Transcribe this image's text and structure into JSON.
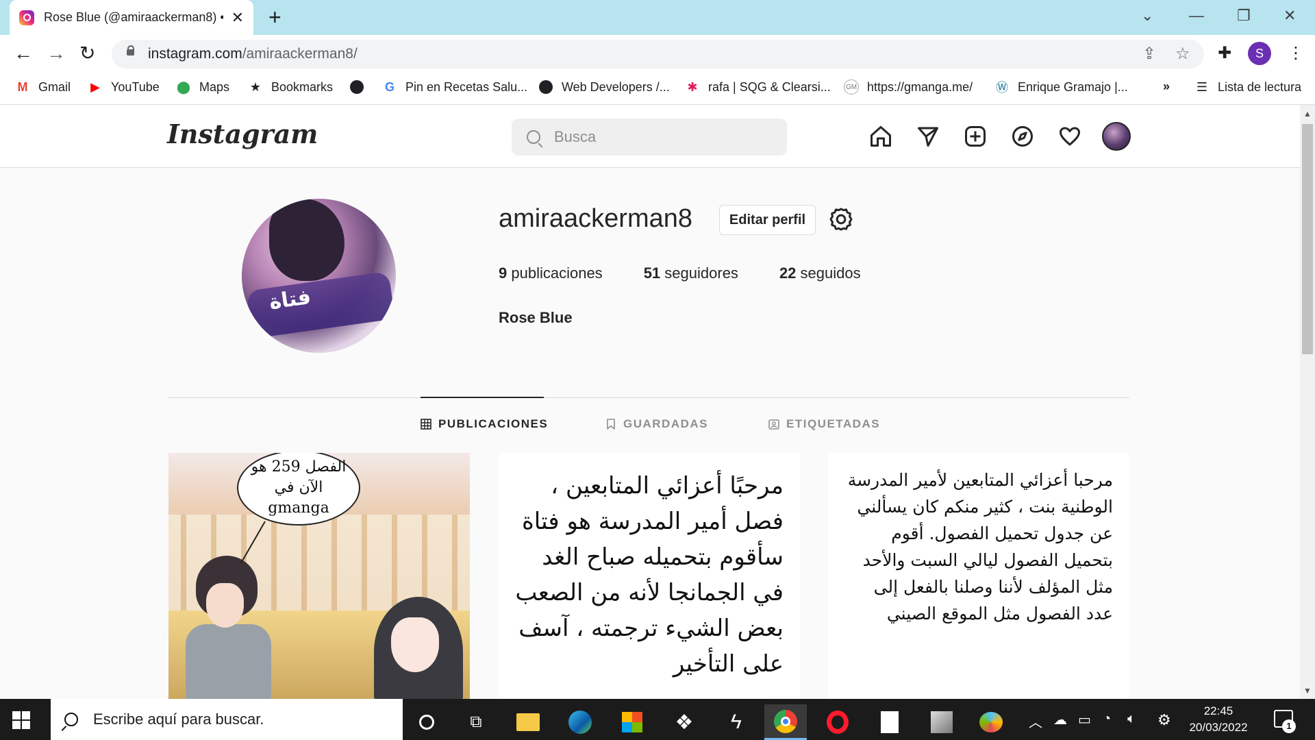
{
  "browser": {
    "tab_title": "Rose Blue (@amiraackerman8) • I",
    "url_host": "instagram.com",
    "url_path": "/amiraackerman8/",
    "profile_initial": "S",
    "bookmarks": [
      {
        "label": "Gmail",
        "icon": "gmail-icon"
      },
      {
        "label": "YouTube",
        "icon": "youtube-icon"
      },
      {
        "label": "Maps",
        "icon": "maps-icon"
      },
      {
        "label": "Bookmarks",
        "icon": "star-icon"
      },
      {
        "label": "",
        "icon": "globe-icon"
      },
      {
        "label": "Pin en Recetas Salu...",
        "icon": "google-icon"
      },
      {
        "label": "Web Developers /...",
        "icon": "globe-icon"
      },
      {
        "label": "rafa | SQG & Clearsi...",
        "icon": "slack-icon"
      },
      {
        "label": "https://gmanga.me/",
        "icon": "gmanga-icon"
      },
      {
        "label": "Enrique Gramajo |...",
        "icon": "wordpress-icon"
      }
    ],
    "bookmarks_overflow": "»",
    "reading_list": "Lista de lectura"
  },
  "instagram": {
    "logo": "Instagram",
    "search_placeholder": "Busca",
    "username": "amiraackerman8",
    "edit_profile": "Editar perfil",
    "stats": {
      "posts_count": "9",
      "posts_label": "publicaciones",
      "followers_count": "51",
      "followers_label": "seguidores",
      "following_count": "22",
      "following_label": "seguidos"
    },
    "full_name": "Rose Blue",
    "profile_pic_text": "فتاة",
    "tabs": [
      {
        "label": "PUBLICACIONES",
        "active": true
      },
      {
        "label": "GUARDADAS",
        "active": false
      },
      {
        "label": "ETIQUETADAS",
        "active": false
      }
    ],
    "posts": [
      {
        "bubble_lines": [
          "الفصل 259 هو",
          "الآن في",
          "gmanga"
        ]
      },
      {
        "text": "مرحبًا أعزائي المتابعين ، فصل أمير المدرسة هو فتاة سأقوم بتحميله صباح الغد في الجمانجا لأنه من الصعب بعض الشيء ترجمته ، آسف على التأخير"
      },
      {
        "text": "مرحبا أعزائي المتابعين لأمير المدرسة الوطنية بنت ، كثير منكم كان يسألني عن جدول تحميل الفصول. أقوم بتحميل الفصول ليالي السبت والأحد مثل المؤلف لأننا وصلنا بالفعل إلى عدد الفصول مثل الموقع الصيني"
      }
    ]
  },
  "taskbar": {
    "search_placeholder": "Escribe aquí para buscar.",
    "time": "22:45",
    "date": "20/03/2022",
    "notification_count": "1"
  }
}
